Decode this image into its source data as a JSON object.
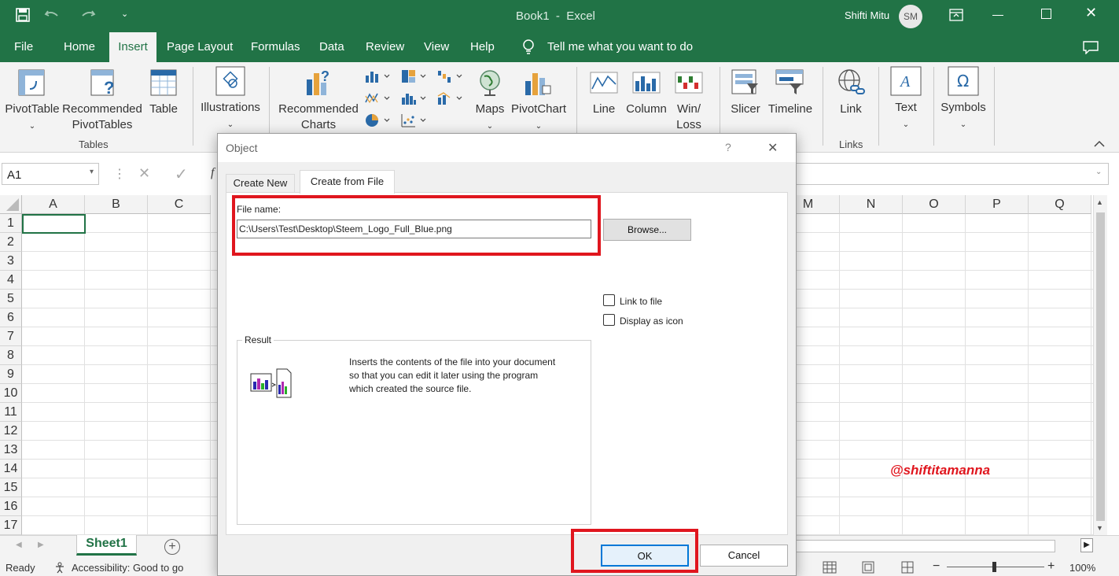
{
  "app": {
    "title": "Book1  -  Excel",
    "user_name": "Shifti Mitu",
    "user_initials": "SM",
    "brand_color": "#217346"
  },
  "tabs": [
    "File",
    "Home",
    "Insert",
    "Page Layout",
    "Formulas",
    "Data",
    "Review",
    "View",
    "Help"
  ],
  "active_tab": "Insert",
  "tell_me": "Tell me what you want to do",
  "ribbon": {
    "pivottable": "PivotTable",
    "recommended_pivottables_1": "Recommended",
    "recommended_pivottables_2": "PivotTables",
    "table": "Table",
    "tables_group": "Tables",
    "illustrations": "Illustrations",
    "recommended_charts_1": "Recommended",
    "recommended_charts_2": "Charts",
    "maps": "Maps",
    "pivotchart": "PivotChart",
    "line": "Line",
    "column": "Column",
    "winloss_1": "Win/",
    "winloss_2": "Loss",
    "slicer": "Slicer",
    "timeline": "Timeline",
    "link": "Link",
    "links_group": "Links",
    "text": "Text",
    "symbols": "Symbols"
  },
  "formula_bar": {
    "name_box": "A1",
    "fx": "f"
  },
  "columns_left": [
    "A",
    "B",
    "C"
  ],
  "columns_right": [
    "M",
    "N",
    "O",
    "P",
    "Q"
  ],
  "rows": [
    "1",
    "2",
    "3",
    "4",
    "5",
    "6",
    "7",
    "8",
    "9",
    "10",
    "11",
    "12",
    "13",
    "14",
    "15",
    "16",
    "17"
  ],
  "dialog": {
    "title": "Object",
    "help": "?",
    "close": "✕",
    "tab_create_new": "Create New",
    "tab_create_from_file": "Create from File",
    "file_name_label": "File name:",
    "file_name_value": "C:\\Users\\Test\\Desktop\\Steem_Logo_Full_Blue.png",
    "browse": "Browse...",
    "link_to_file": "Link to file",
    "display_as_icon": "Display as icon",
    "result_label": "Result",
    "result_text_1": "Inserts the contents of the file into your document",
    "result_text_2": "so that you can edit it later using the program",
    "result_text_3": "which created the source file.",
    "ok": "OK",
    "cancel": "Cancel",
    "highlight_color": "#e0161e"
  },
  "watermark": "@shiftitamanna",
  "sheet_tab": "Sheet1",
  "status": {
    "ready": "Ready",
    "accessibility": "Accessibility: Good to go",
    "zoom": "100%"
  }
}
